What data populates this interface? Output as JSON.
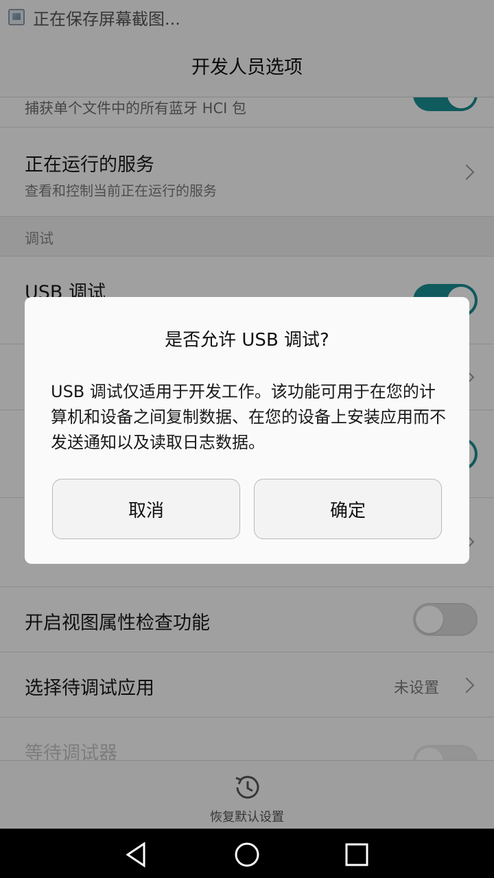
{
  "status_bar": {
    "text": "正在保存屏幕截图..."
  },
  "header": {
    "title": "开发人员选项"
  },
  "list": {
    "partial_top_text": "捕获单个文件中的所有蓝牙 HCI 包",
    "running_services": {
      "title": "正在运行的服务",
      "subtitle": "查看和控制当前正在运行的服务"
    },
    "section_debug": "调试",
    "usb_debugging": {
      "title": "USB 调试",
      "toggle": "on"
    },
    "view_attribute_inspection": {
      "title": "开启视图属性检查功能",
      "toggle": "off"
    },
    "select_debug_app": {
      "title": "选择待调试应用",
      "value": "未设置"
    },
    "wait_for_debugger": {
      "title": "等待调试器",
      "toggle": "off"
    }
  },
  "bottom_action": {
    "label": "恢复默认设置",
    "icon": "restore-history-icon"
  },
  "dialog": {
    "title": "是否允许 USB 调试?",
    "message": "USB 调试仅适用于开发工作。该功能可用于在您的计算机和设备之间复制数据、在您的设备上安装应用而不发送通知以及读取日志数据。",
    "cancel_label": "取消",
    "ok_label": "确定"
  },
  "nav_bar": {
    "back": "back-triangle-icon",
    "home": "home-circle-icon",
    "recents": "recents-square-icon"
  },
  "colors": {
    "accent": "#1a8f94",
    "background": "#f8f8f8",
    "nav_bar": "#000000"
  }
}
